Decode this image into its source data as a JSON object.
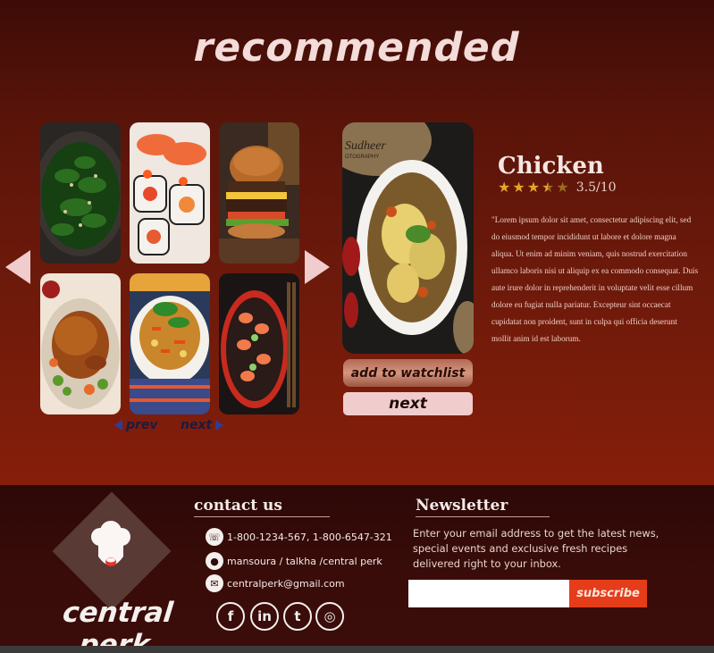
{
  "page": {
    "title": "recommended"
  },
  "carousel": {
    "items": [
      {
        "name": "spinach-dish"
      },
      {
        "name": "sushi-rolls"
      },
      {
        "name": "burger"
      },
      {
        "name": "roast-chicken"
      },
      {
        "name": "stir-fry-bowl"
      },
      {
        "name": "sushi-platter"
      }
    ],
    "prev_label": "prev",
    "next_label": "next"
  },
  "featured": {
    "watermark": "Sudheer OTOGRAPHY",
    "watchlist_label": "add to watchlist",
    "next_label": "next",
    "name": "Chicken",
    "rating_value": 3.5,
    "rating_text": "3.5/10",
    "description": "\"Lorem ipsum dolor sit amet, consectetur adipiscing elit, sed do eiusmod tempor incididunt ut labore et dolore magna aliqua. Ut enim ad minim veniam, quis nostrud exercitation ullamco laboris nisi ut aliquip ex ea commodo consequat. Duis aute irure dolor in reprehenderit in voluptate velit esse cillum dolore eu fugiat nulla pariatur. Excepteur sint occaecat cupidatat non proident, sunt in culpa qui officia deserunt mollit anim id est laborum."
  },
  "footer": {
    "brand": "central perk",
    "contact": {
      "title": "contact us",
      "phone": "1-800-1234-567, 1-800-6547-321",
      "address": "mansoura / talkha /central perk",
      "email": "centralperk@gmail.com"
    },
    "social": [
      {
        "name": "facebook-icon",
        "glyph": "f"
      },
      {
        "name": "linkedin-icon",
        "glyph": "in"
      },
      {
        "name": "twitter-icon",
        "glyph": "t"
      },
      {
        "name": "instagram-icon",
        "glyph": "◎"
      }
    ],
    "newsletter": {
      "title": "Newsletter",
      "text": "Enter your email address to get the latest news, special events and exclusive fresh recipes delivered right to your inbox.",
      "input_value": "",
      "subscribe_label": "subscribe"
    }
  },
  "colors": {
    "accent": "#e53c1a",
    "star": "#e6a52a",
    "pink": "#f1cccc"
  }
}
